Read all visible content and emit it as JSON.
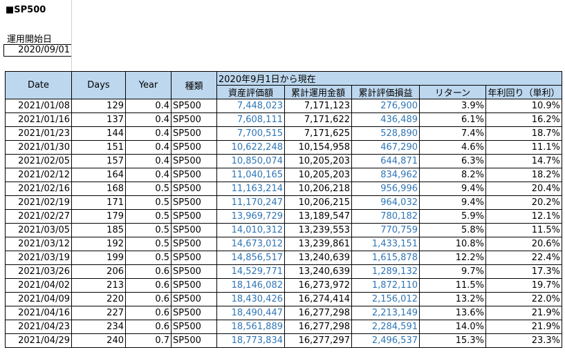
{
  "title": "■SP500",
  "start_label": "運用開始日",
  "start_date": "2020/09/01",
  "table": {
    "headers": {
      "date": "Date",
      "days": "Days",
      "year": "Year",
      "type": "種類"
    },
    "group_header": "2020年9月1日から現在",
    "sub_headers": [
      "資産評価額",
      "累計運用金額",
      "累計評価損益",
      "リターン",
      "年利回り（単利）"
    ],
    "rows": [
      [
        "2021/01/08",
        "129",
        "0.4",
        "SP500",
        "7,448,023",
        "7,171,123",
        "276,900",
        "3.9%",
        "10.9%"
      ],
      [
        "2021/01/16",
        "137",
        "0.4",
        "SP500",
        "7,608,111",
        "7,171,622",
        "436,489",
        "6.1%",
        "16.2%"
      ],
      [
        "2021/01/23",
        "144",
        "0.4",
        "SP500",
        "7,700,515",
        "7,171,625",
        "528,890",
        "7.4%",
        "18.7%"
      ],
      [
        "2021/01/30",
        "151",
        "0.4",
        "SP500",
        "10,622,248",
        "10,154,958",
        "467,290",
        "4.6%",
        "11.1%"
      ],
      [
        "2021/02/05",
        "157",
        "0.4",
        "SP500",
        "10,850,074",
        "10,205,203",
        "644,871",
        "6.3%",
        "14.7%"
      ],
      [
        "2021/02/12",
        "164",
        "0.4",
        "SP500",
        "11,040,165",
        "10,205,203",
        "834,962",
        "8.2%",
        "18.2%"
      ],
      [
        "2021/02/16",
        "168",
        "0.5",
        "SP500",
        "11,163,214",
        "10,206,218",
        "956,996",
        "9.4%",
        "20.4%"
      ],
      [
        "2021/02/19",
        "171",
        "0.5",
        "SP500",
        "11,170,247",
        "10,206,215",
        "964,032",
        "9.4%",
        "20.2%"
      ],
      [
        "2021/02/27",
        "179",
        "0.5",
        "SP500",
        "13,969,729",
        "13,189,547",
        "780,182",
        "5.9%",
        "12.1%"
      ],
      [
        "2021/03/05",
        "185",
        "0.5",
        "SP500",
        "14,010,312",
        "13,239,553",
        "770,759",
        "5.8%",
        "11.5%"
      ],
      [
        "2021/03/12",
        "192",
        "0.5",
        "SP500",
        "14,673,012",
        "13,239,861",
        "1,433,151",
        "10.8%",
        "20.6%"
      ],
      [
        "2021/03/19",
        "199",
        "0.5",
        "SP500",
        "14,856,517",
        "13,240,639",
        "1,615,878",
        "12.2%",
        "22.4%"
      ],
      [
        "2021/03/26",
        "206",
        "0.6",
        "SP500",
        "14,529,771",
        "13,240,639",
        "1,289,132",
        "9.7%",
        "17.3%"
      ],
      [
        "2021/04/02",
        "213",
        "0.6",
        "SP500",
        "18,146,082",
        "16,273,972",
        "1,872,110",
        "11.5%",
        "19.7%"
      ],
      [
        "2021/04/09",
        "220",
        "0.6",
        "SP500",
        "18,430,426",
        "16,274,414",
        "2,156,012",
        "13.2%",
        "22.0%"
      ],
      [
        "2021/04/16",
        "227",
        "0.6",
        "SP500",
        "18,490,447",
        "16,277,298",
        "2,213,149",
        "13.6%",
        "21.9%"
      ],
      [
        "2021/04/23",
        "234",
        "0.6",
        "SP500",
        "18,561,889",
        "16,277,298",
        "2,284,591",
        "14.0%",
        "21.9%"
      ],
      [
        "2021/04/29",
        "240",
        "0.7",
        "SP500",
        "18,773,834",
        "16,277,297",
        "2,496,537",
        "15.3%",
        "23.3%"
      ]
    ]
  },
  "colors": {
    "header_bg": "#bdd7ee",
    "value_blue": "#2e75b6"
  }
}
